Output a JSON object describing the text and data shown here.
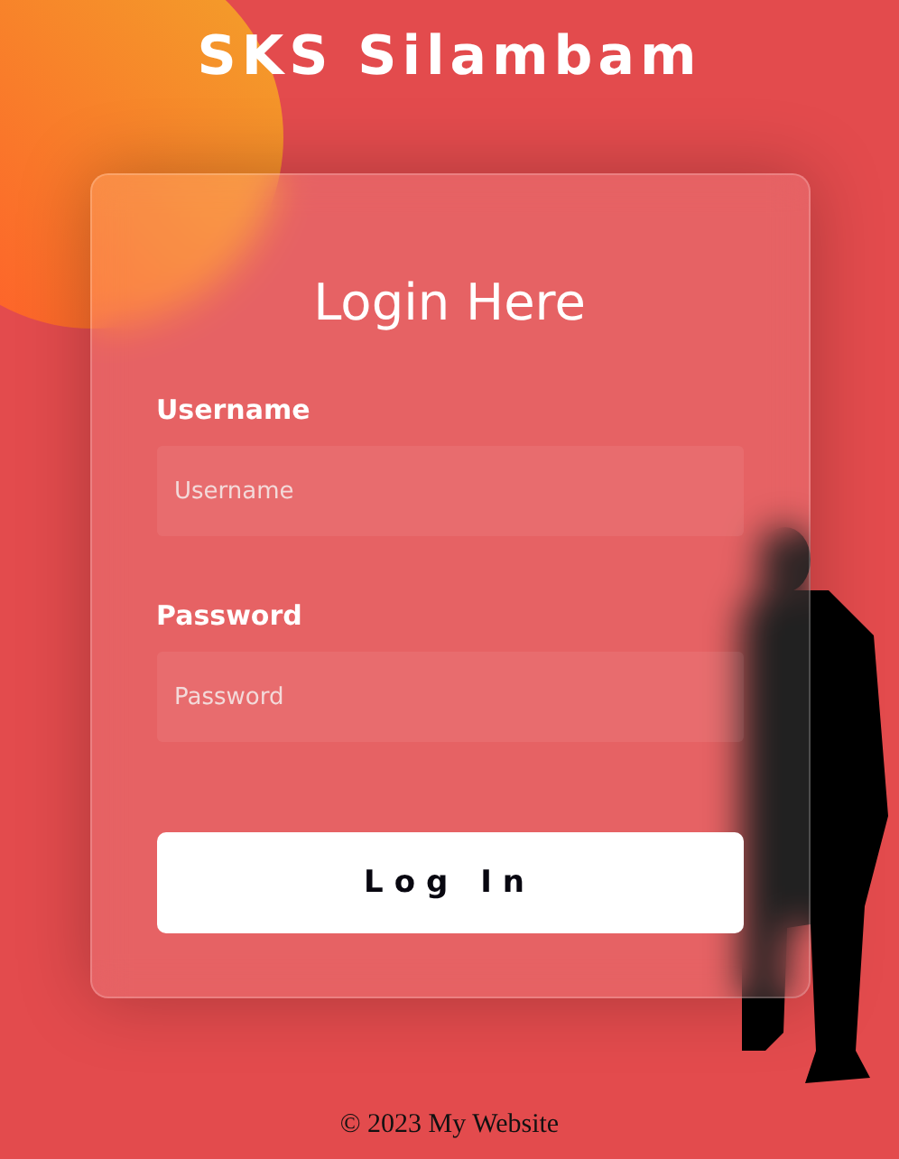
{
  "site_title": "SKS Silambam",
  "form": {
    "heading": "Login Here",
    "fields": [
      {
        "label": "Username",
        "placeholder": "Username"
      },
      {
        "label": "Password",
        "placeholder": "Password"
      }
    ],
    "submit": "Log In"
  },
  "footer": "© 2023 My Website"
}
